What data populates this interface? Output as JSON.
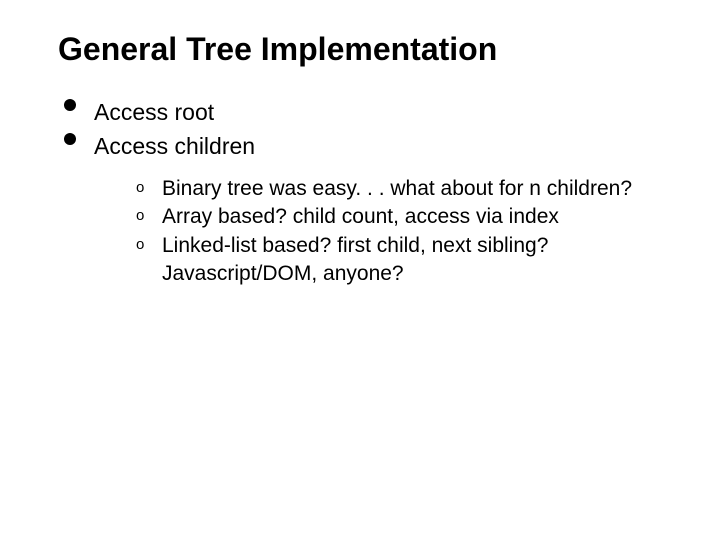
{
  "title": "General Tree Implementation",
  "bullets": {
    "b0": "Access root",
    "b1": "Access children",
    "sub": {
      "s0": "Binary tree was easy. . . what about for n children?",
      "s1": "Array based? child count, access via index",
      "s2": "Linked-list based? first child, next sibling? Javascript/DOM, anyone?"
    }
  }
}
